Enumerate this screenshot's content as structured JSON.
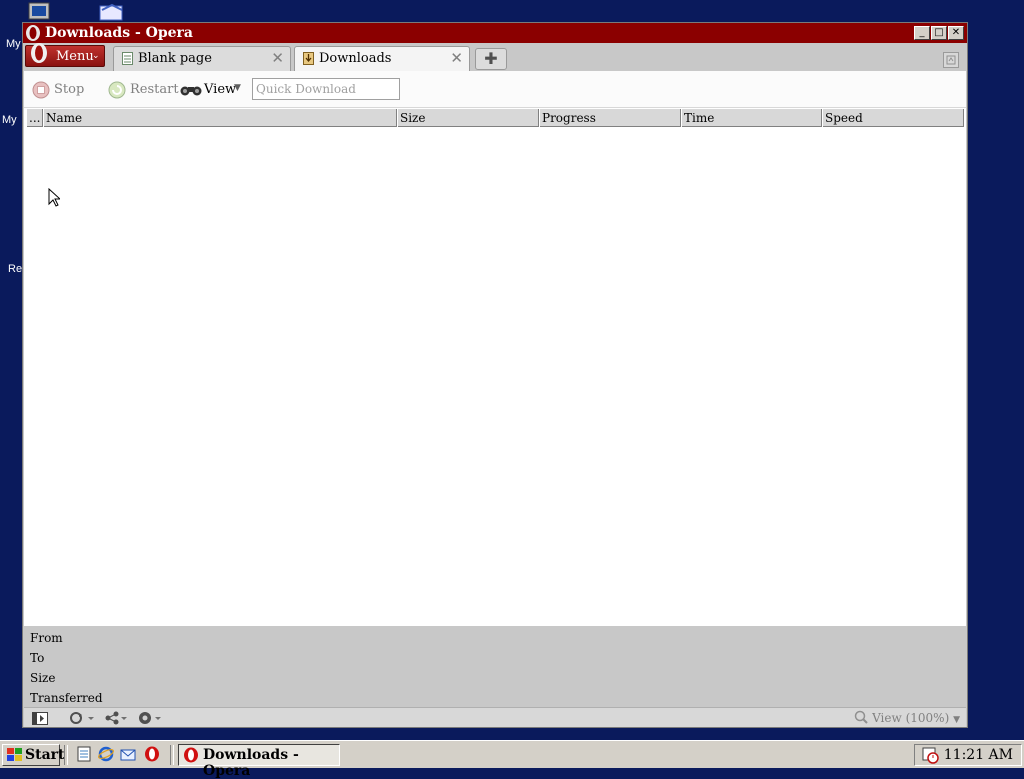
{
  "desktop": {
    "labels": [
      "My",
      "My",
      "Re"
    ]
  },
  "window": {
    "title": "Downloads - Opera",
    "buttons": {
      "minimize": "_",
      "maximize": "□",
      "close": "✕"
    }
  },
  "menu": {
    "label": "Menu",
    "caret": "⌄"
  },
  "tabs": [
    {
      "label": "Blank page",
      "close": "✕",
      "icon": "page-icon"
    },
    {
      "label": "Downloads",
      "close": "✕",
      "icon": "download-icon"
    }
  ],
  "new_tab": "✚",
  "toolbar": {
    "stop_label": "Stop",
    "restart_label": "Restart",
    "view_label": "View",
    "quick_download_placeholder": "Quick Download"
  },
  "columns": {
    "more": "...",
    "name": "Name",
    "size": "Size",
    "progress": "Progress",
    "time": "Time",
    "speed": "Speed"
  },
  "details": {
    "from_label": "From",
    "to_label": "To",
    "size_label": "Size",
    "transferred_label": "Transferred"
  },
  "statusbar": {
    "zoom_label": "View (100%)"
  },
  "taskbar": {
    "start_label": "Start",
    "task_label": "Downloads - Opera",
    "clock": "11:21 AM"
  },
  "colors": {
    "titlebar": "#8b0000",
    "desktop": "#0a1a5c",
    "menu_button": "#b0201c"
  }
}
